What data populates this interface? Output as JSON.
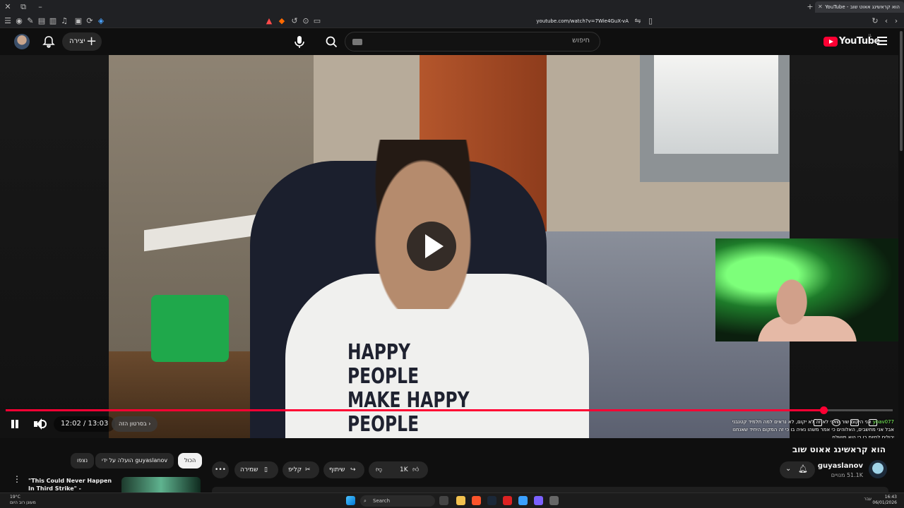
{
  "browser": {
    "tab_title": "הוא קראשינג אאוט שוב - YouTube",
    "url": "youtube.com/watch?v=7Wie4GuX-vA"
  },
  "header": {
    "create_label": "יצירה",
    "search_placeholder": "חיפוש",
    "logo_text": "YouTube",
    "logo_region": "IL"
  },
  "player": {
    "current_time": "12:02",
    "duration": "13:03",
    "time_display": "12:02 / 13:03",
    "progress": 0.922,
    "chapter_label": "בסרטון הזה",
    "shirt_text": [
      "HAPPY PEOPLE",
      "MAKE HAPPY",
      "PEOPLE"
    ],
    "chat": {
      "user": "yoav077",
      "message": "אני היקום שור שאני לא זה לא יקום, לא נראים למה תלמיד קטנבני אבל אני מחשבים, האלוהים כי אמר משהו נאיה בו כי זה המקום היחיד שאנחנו יכולים לחיות בו כי הוא מושלם"
    }
  },
  "video": {
    "title": "הוא קראשינג אאוט שוב",
    "channel_name": "guyaslanov",
    "subscribers": "51.1K מנויים",
    "like_count": "1K",
    "share_label": "שיתוף",
    "clip_label": "קליפ",
    "save_label": "שמירה"
  },
  "recommendations": {
    "chips": [
      "הכול",
      "הועלה על ידי guyaslanov",
      "נצפו"
    ],
    "first_title": "\"This Could Never Happen In Third Strike\" - LowTierGod Part"
  },
  "taskbar": {
    "weather_temp": "19°C",
    "weather_desc": "מעונן רוב היום",
    "search_label": "Search",
    "time": "16:43",
    "date": "06/01/2026",
    "lang": "עבר"
  },
  "colors": {
    "accent": "#ff0033",
    "background": "#0f0f0f",
    "surface": "#272727",
    "chat_user": "#7cff5a"
  }
}
